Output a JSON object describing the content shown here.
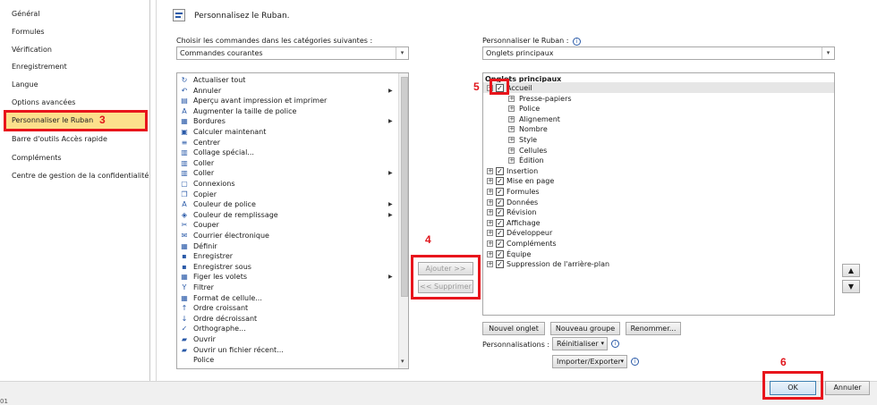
{
  "nav": {
    "items": [
      "Général",
      "Formules",
      "Vérification",
      "Enregistrement",
      "Langue",
      "Options avancées",
      "Personnaliser le Ruban",
      "Barre d'outils Accès rapide",
      "Compléments",
      "Centre de gestion de la confidentialité"
    ]
  },
  "annotations": {
    "a3": "3",
    "a4": "4",
    "a5": "5",
    "a6": "6"
  },
  "header": {
    "title": "Personnalisez le Ruban."
  },
  "left": {
    "label": "Choisir les commandes dans les catégories suivantes :",
    "select_value": "Commandes courantes",
    "commands": [
      {
        "label": "Actualiser tout",
        "icon": "↻",
        "sub": false
      },
      {
        "label": "Annuler",
        "icon": "↶",
        "sub": true
      },
      {
        "label": "Aperçu avant impression et imprimer",
        "icon": "▤",
        "sub": false
      },
      {
        "label": "Augmenter la taille de police",
        "icon": "A",
        "sub": false
      },
      {
        "label": "Bordures",
        "icon": "▦",
        "sub": true
      },
      {
        "label": "Calculer maintenant",
        "icon": "▣",
        "sub": false
      },
      {
        "label": "Centrer",
        "icon": "≡",
        "sub": false
      },
      {
        "label": "Collage spécial...",
        "icon": "▥",
        "sub": false
      },
      {
        "label": "Coller",
        "icon": "▥",
        "sub": false
      },
      {
        "label": "Coller",
        "icon": "▥",
        "sub": true
      },
      {
        "label": "Connexions",
        "icon": "▢",
        "sub": false
      },
      {
        "label": "Copier",
        "icon": "❐",
        "sub": false
      },
      {
        "label": "Couleur de police",
        "icon": "A",
        "sub": true
      },
      {
        "label": "Couleur de remplissage",
        "icon": "◈",
        "sub": true
      },
      {
        "label": "Couper",
        "icon": "✂",
        "sub": false
      },
      {
        "label": "Courrier électronique",
        "icon": "✉",
        "sub": false
      },
      {
        "label": "Définir",
        "icon": "▦",
        "sub": false
      },
      {
        "label": "Enregistrer",
        "icon": "▪",
        "sub": false
      },
      {
        "label": "Enregistrer sous",
        "icon": "▪",
        "sub": false
      },
      {
        "label": "Figer les volets",
        "icon": "▦",
        "sub": true
      },
      {
        "label": "Filtrer",
        "icon": "Y",
        "sub": false
      },
      {
        "label": "Format de cellule...",
        "icon": "▦",
        "sub": false
      },
      {
        "label": "Ordre croissant",
        "icon": "↑",
        "sub": false
      },
      {
        "label": "Ordre décroissant",
        "icon": "↓",
        "sub": false
      },
      {
        "label": "Orthographe...",
        "icon": "✓",
        "sub": false
      },
      {
        "label": "Ouvrir",
        "icon": "▰",
        "sub": false
      },
      {
        "label": "Ouvrir un fichier récent...",
        "icon": "▰",
        "sub": false
      },
      {
        "label": "Police",
        "icon": "",
        "sub": false
      }
    ]
  },
  "middle": {
    "add_label": "Ajouter >>",
    "remove_label": "<< Supprimer"
  },
  "right": {
    "label": "Personnaliser le Ruban :",
    "select_value": "Onglets principaux",
    "group_header": "Onglets principaux",
    "accueil": "Accueil",
    "accueil_children": [
      "Presse-papiers",
      "Police",
      "Alignement",
      "Nombre",
      "Style",
      "Cellules",
      "Édition"
    ],
    "tabs": [
      "Insertion",
      "Mise en page",
      "Formules",
      "Données",
      "Révision",
      "Affichage",
      "Développeur",
      "Compléments",
      "Équipe",
      "Suppression de l'arrière-plan"
    ],
    "new_tab": "Nouvel onglet",
    "new_group": "Nouveau groupe",
    "rename": "Renommer...",
    "customizations_label": "Personnalisations :",
    "reset": "Réinitialiser",
    "import_export": "Importer/Exporter"
  },
  "footer": {
    "ok": "OK",
    "cancel": "Annuler",
    "bottom_corner": "01"
  }
}
